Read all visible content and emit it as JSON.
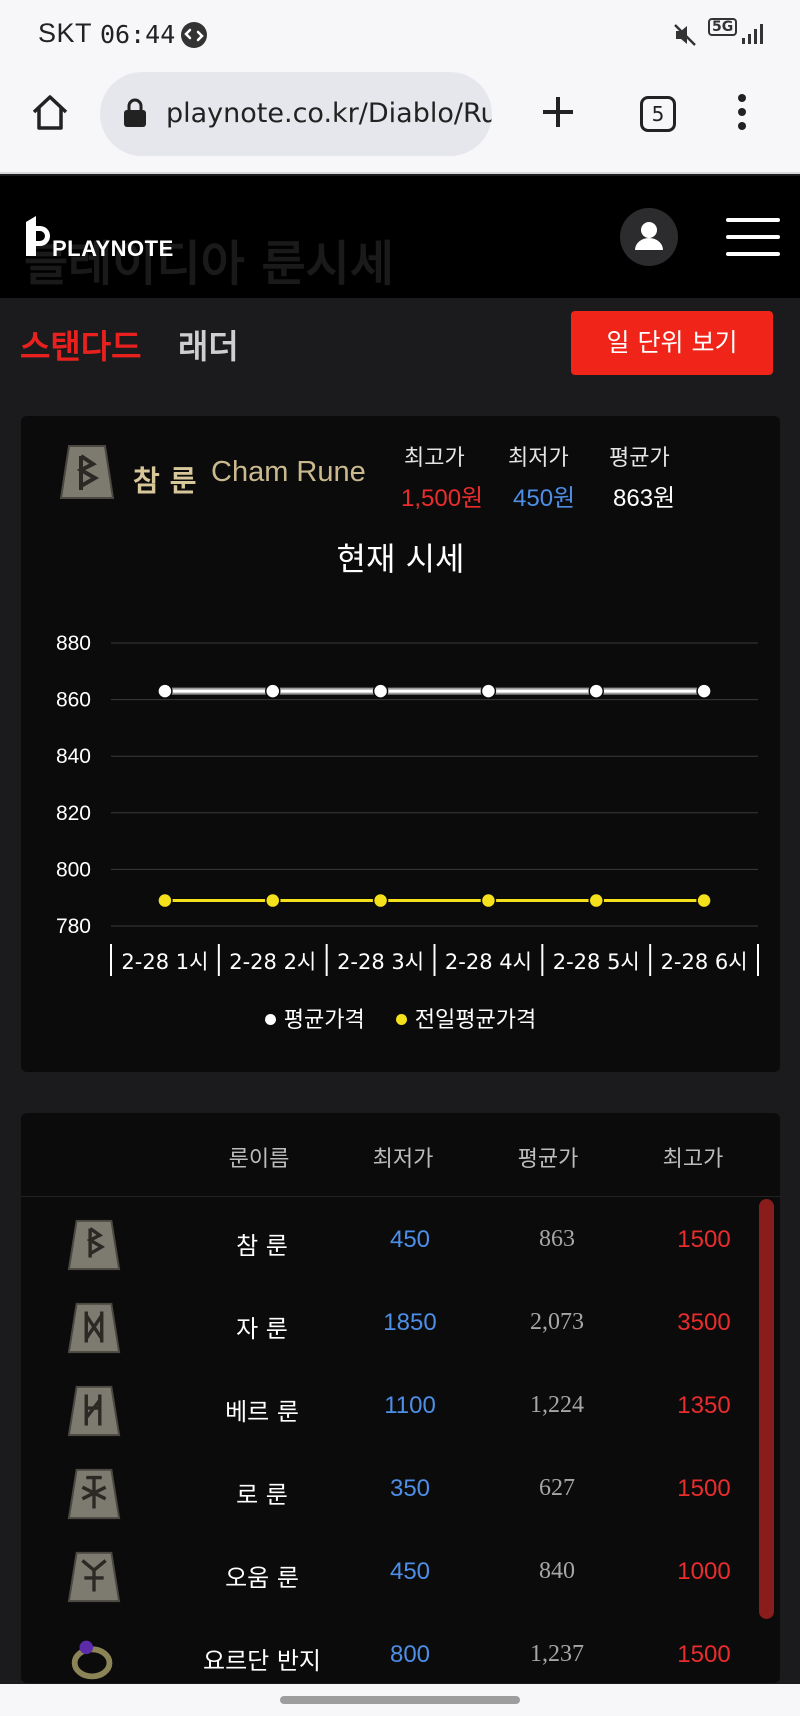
{
  "status_bar": {
    "carrier": "SKT",
    "time": "06:44",
    "network": "5G"
  },
  "browser": {
    "url": "playnote.co.kr/Diablo/Rur",
    "tab_count": "5",
    "icons": [
      "home-icon",
      "lock-icon",
      "plus-icon",
      "more-vert-icon"
    ]
  },
  "header": {
    "logo_text": "PLAYNOTE",
    "ghost_title": "블레이디아 룬시세"
  },
  "mode_tabs": {
    "standard": "스탠다드",
    "ladder": "래더",
    "daily_button": "일 단위 보기"
  },
  "rune_card": {
    "name_ko": "참 룬",
    "name_en": "Cham Rune",
    "max_label": "최고가",
    "max_value": "1,500원",
    "min_label": "최저가",
    "min_value": "450원",
    "avg_label": "평균가",
    "avg_value": "863원",
    "chart_title": "현재 시세"
  },
  "chart_data": {
    "type": "line",
    "x": [
      "2-28 1시",
      "2-28 2시",
      "2-28 3시",
      "2-28 4시",
      "2-28 5시",
      "2-28 6시"
    ],
    "series": [
      {
        "name": "평균가격",
        "values": [
          863,
          863,
          863,
          863,
          863,
          863
        ],
        "color": "#ffffff"
      },
      {
        "name": "전일평균가격",
        "values": [
          789,
          789,
          789,
          789,
          789,
          789
        ],
        "color": "#f5e11b"
      }
    ],
    "yticks": [
      780,
      800,
      820,
      840,
      860,
      880
    ],
    "ylim": [
      780,
      880
    ],
    "grid": true,
    "legend": "bottom"
  },
  "table": {
    "headers": [
      "룬이름",
      "최저가",
      "평균가",
      "최고가"
    ],
    "rows": [
      {
        "name": "참 룬",
        "min": "450",
        "avg": "863",
        "max": "1500",
        "icon": "cham-rune-icon"
      },
      {
        "name": "자 룬",
        "min": "1850",
        "avg": "2,073",
        "max": "3500",
        "icon": "zod-rune-icon"
      },
      {
        "name": "베르 룬",
        "min": "1100",
        "avg": "1,224",
        "max": "1350",
        "icon": "ber-rune-icon"
      },
      {
        "name": "로 룬",
        "min": "350",
        "avg": "627",
        "max": "1500",
        "icon": "lo-rune-icon"
      },
      {
        "name": "오움 룬",
        "min": "450",
        "avg": "840",
        "max": "1000",
        "icon": "ohm-rune-icon"
      },
      {
        "name": "요르단 반지",
        "min": "800",
        "avg": "1,237",
        "max": "1500",
        "icon": "jordan-ring-icon"
      }
    ]
  },
  "colors": {
    "accent_red": "#f02419",
    "min_blue": "#4d8ee6",
    "max_red": "#ea2c2c",
    "gold": "#d8c79a"
  }
}
